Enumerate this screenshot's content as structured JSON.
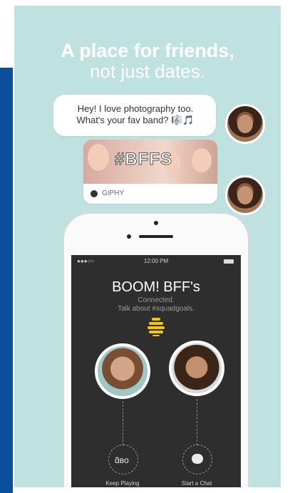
{
  "promo": {
    "headline_line1": "A place for friends,",
    "headline_line2": "not just dates."
  },
  "chat": {
    "message_line1": "Hey! I love photography too.",
    "message_line2": "What's your fav band? 🎼🎵",
    "gif_text": "#BFFS",
    "gif_source": "GIPHY"
  },
  "phone": {
    "status_time": "12:00 PM",
    "status_signal": "●●●○○",
    "match_title": "BOOM! BFF's",
    "match_sub1": "Connected.",
    "match_sub2": "Talk about #squadgoals.",
    "keep_playing": "Keep Playing",
    "start_chat": "Start a Chat",
    "keep_icon_glyph": "ɑ̃ʙo"
  },
  "colors": {
    "background": "#bfe1df",
    "brand_yellow": "#f3c61a",
    "screen": "#2e2e2e",
    "side_strip": "#0a4f9d"
  }
}
